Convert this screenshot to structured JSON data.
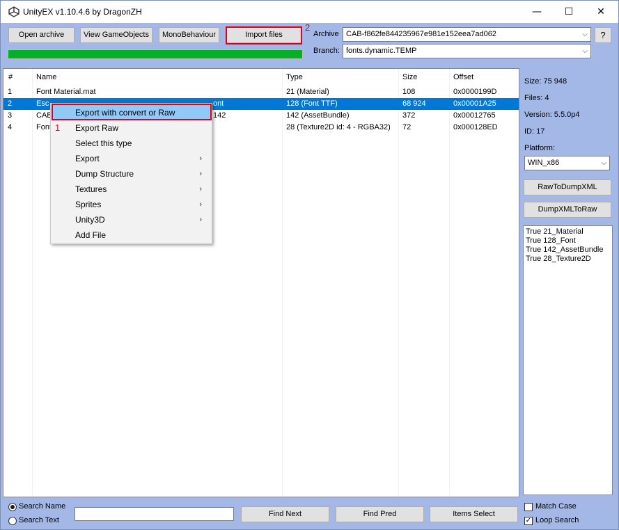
{
  "window": {
    "title": "UnityEX v1.10.4.6 by DragonZH",
    "minimize_glyph": "—",
    "maximize_glyph": "☐",
    "close_glyph": "✕"
  },
  "toolbar": {
    "open_archive": "Open archive",
    "view_gameobjects": "View GameObjects",
    "monobehaviour": "MonoBehaviour",
    "import_files": "Import files",
    "help": "?"
  },
  "annotations": {
    "label_1": "1",
    "label_2": "2"
  },
  "archive": {
    "label": "Archive",
    "value": "CAB-f862fe844235967e981e152eea7ad062"
  },
  "branch": {
    "label": "Branch:",
    "value": "fonts.dynamic.TEMP"
  },
  "progress": {
    "fraction": 1.0,
    "color": "#06b025"
  },
  "table": {
    "columns": [
      "#",
      "Name",
      "Type",
      "Size",
      "Offset"
    ],
    "rows": [
      [
        "1",
        "Font Material.mat",
        "21 (Material)",
        "108",
        "0x0000199D"
      ],
      [
        "2",
        "Esc",
        "128 (Font TTF)",
        "68 924",
        "0x00001A25"
      ],
      [
        "3",
        "CAB",
        "142 (AssetBundle)",
        "372",
        "0x00012765"
      ],
      [
        "4",
        "Font",
        "28 (Texture2D id: 4 - RGBA32)",
        "72",
        "0x000128ED"
      ]
    ],
    "row2_partial_tail": "ont",
    "row3_partial_tail": "142",
    "selected_row": 2
  },
  "context_menu": {
    "items": [
      {
        "label": "Export with convert or Raw",
        "submenu": false
      },
      {
        "label": "Export Raw",
        "submenu": false
      },
      {
        "label": "Select this type",
        "submenu": false
      },
      {
        "label": "Export",
        "submenu": true
      },
      {
        "label": "Dump Structure",
        "submenu": true
      },
      {
        "label": "Textures",
        "submenu": true
      },
      {
        "label": "Sprites",
        "submenu": true
      },
      {
        "label": "Unity3D",
        "submenu": true
      },
      {
        "label": "Add File",
        "submenu": false
      }
    ],
    "arrow_glyph": "›"
  },
  "side": {
    "size": "Size: 75 948",
    "files": "Files: 4",
    "version": "Version: 5.5.0p4",
    "id": "ID: 17",
    "platform_label": "Platform:",
    "platform_value": "WIN_x86",
    "raw_to_dump": "RawToDumpXML",
    "dump_to_raw": "DumpXMLToRaw",
    "log": [
      "True 21_Material",
      "True 128_Font",
      "True 142_AssetBundle",
      "True 28_Texture2D"
    ]
  },
  "search": {
    "search_name": "Search Name",
    "search_text": "Search Text",
    "query": "",
    "find_next": "Find Next",
    "find_pred": "Find Pred",
    "items_select": "Items Select",
    "match_case": "Match Case",
    "loop_search": "Loop Search",
    "loop_search_checked": true,
    "match_case_checked": false
  },
  "colors": {
    "window_bg": "#a3b8e6",
    "selection": "#0078d7",
    "highlight_outline": "#e0001c",
    "menu_highlight": "#91c9f7"
  }
}
